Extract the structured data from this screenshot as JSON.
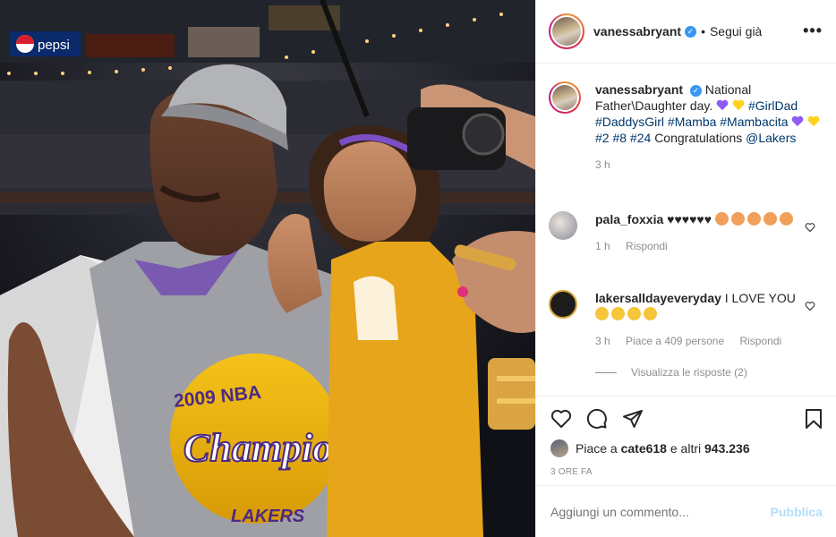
{
  "post": {
    "author": "vanessabryant",
    "follow_status": "Segui già",
    "dot": "•",
    "more": "•••"
  },
  "photo": {
    "pepsi_text": "pepsi",
    "shirt_text_top": "2009 NBA",
    "shirt_text_main": "Champions",
    "shirt_text_team": "LAKERS"
  },
  "caption": {
    "user": "vanessabryant",
    "line1": "National Father\\Daughter day.",
    "tags1": "#GirlDad #DaddysGirl #Mamba #Mambacita",
    "tags2": "#2 #8 #24",
    "text2": "Congratulations",
    "mention": "@Lakers",
    "time": "3 h"
  },
  "comments": [
    {
      "user": "pala_foxxia",
      "text": "♥♥♥♥♥♥",
      "time": "1 h",
      "reply": "Rispondi"
    },
    {
      "user": "lakersalldayeveryday",
      "text": "I LOVE YOU",
      "time": "3 h",
      "likes": "Piace a 409 persone",
      "reply": "Rispondi"
    }
  ],
  "view_replies": "Visualizza le risposte (2)",
  "likes": {
    "prefix": "Piace a",
    "user": "cate618",
    "suffix": "e altri",
    "count": "943.236"
  },
  "post_time": "3 ORE FA",
  "comment_box": {
    "placeholder": "Aggiungi un commento...",
    "publish": "Pubblica"
  },
  "colors": {
    "verified": "#3897f0",
    "link": "#00376b",
    "purple_heart": "#8e5cf5",
    "yellow_heart": "#ffd21f",
    "lakers_gold": "#f2b705",
    "publish_disabled": "#b2dffc"
  },
  "icons": [
    "heart-icon",
    "comment-icon",
    "share-icon",
    "bookmark-icon",
    "more-icon",
    "verified-icon"
  ]
}
